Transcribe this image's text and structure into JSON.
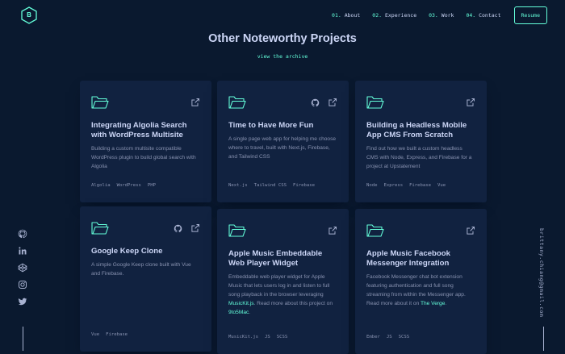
{
  "header": {
    "logo_letter": "B",
    "nav": [
      {
        "num": "01.",
        "label": "About"
      },
      {
        "num": "02.",
        "label": "Experience"
      },
      {
        "num": "03.",
        "label": "Work"
      },
      {
        "num": "04.",
        "label": "Contact"
      }
    ],
    "resume_label": "Resume"
  },
  "section": {
    "title": "Other Noteworthy Projects",
    "archive_link": "view the archive"
  },
  "projects": [
    {
      "title": "Integrating Algolia Search with WordPress Multisite",
      "desc": "Building a custom multisite compatible WordPress plugin to build global search with Algolia",
      "tags": [
        "Algolia",
        "WordPress",
        "PHP"
      ],
      "github": false
    },
    {
      "title": "Time to Have More Fun",
      "desc": "A single page web app for helping me choose where to travel, built with Next.js, Firebase, and Tailwind CSS",
      "tags": [
        "Next.js",
        "Tailwind CSS",
        "Firebase"
      ],
      "github": true
    },
    {
      "title": "Building a Headless Mobile App CMS From Scratch",
      "desc": "Find out how we built a custom headless CMS with Node, Express, and Firebase for a project at Upstatement",
      "tags": [
        "Node",
        "Express",
        "Firebase",
        "Vue"
      ],
      "github": false
    },
    {
      "title": "Google Keep Clone",
      "desc": "A simple Google Keep clone built with Vue and Firebase.",
      "tags": [
        "Vue",
        "Firebase"
      ],
      "github": true
    },
    {
      "title": "Apple Music Embeddable Web Player Widget",
      "desc_parts": [
        "Embeddable web player widget for Apple Music that lets users log in and listen to full song playback in the browser leveraging ",
        "MusicKit.js",
        ". Read more about this project on ",
        "9to5Mac",
        "."
      ],
      "tags": [
        "MusicKit.js",
        "JS",
        "SCSS"
      ],
      "github": false
    },
    {
      "title": "Apple Music Facebook Messenger Integration",
      "desc_parts": [
        "Facebook Messenger chat bot extension featuring authentication and full song streaming from within the Messenger app. Read more about it on ",
        "The Verge",
        "."
      ],
      "tags": [
        "Ember",
        "JS",
        "SCSS"
      ],
      "github": false
    }
  ],
  "email": "brittany.chiang@gmail.com",
  "colors": {
    "bg": "#0a192f",
    "card": "#112240",
    "accent": "#64ffda",
    "heading": "#ccd6f6",
    "text": "#8892b0"
  }
}
